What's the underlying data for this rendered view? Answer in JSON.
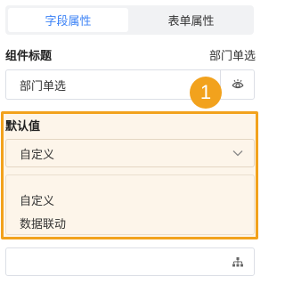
{
  "tabs": [
    {
      "label": "字段属性",
      "active": true
    },
    {
      "label": "表单属性",
      "active": false
    }
  ],
  "component_title": {
    "label": "组件标题",
    "type_value": "部门单选",
    "input_value": "部门单选",
    "visibility_icon": "eye-icon"
  },
  "marker": {
    "number": "1"
  },
  "default_value": {
    "label": "默认值",
    "selected": "自定义",
    "options": [
      "自定义",
      "数据联动"
    ]
  },
  "bottom_field": {
    "icon": "org-chart-icon"
  },
  "colors": {
    "accent": "#3b82f6",
    "highlight": "#f2a21d",
    "highlight_bg": "#fdf5ea"
  }
}
